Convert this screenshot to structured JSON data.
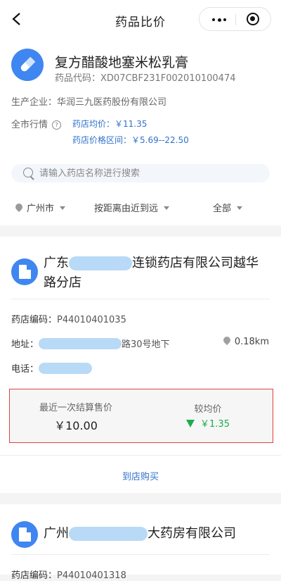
{
  "nav": {
    "title": "药品比价"
  },
  "drug": {
    "name": "复方醋酸地塞米松乳膏",
    "code_label": "药品代码：",
    "code": "XD07CBF231F002010100474",
    "maker_label": "生产企业：",
    "maker": "华润三九医药股份有限公司",
    "market_label": "全市行情",
    "q_mark": "?",
    "avg_label": "药店均价：",
    "avg_value": "￥11.35",
    "range_label": "药店价格区间：",
    "range_value": "￥5.69--22.50"
  },
  "search": {
    "placeholder": "请输入药店名称进行搜索"
  },
  "filters": {
    "city": "广州市",
    "sort": "按距离由近到远",
    "scope": "全部"
  },
  "stores": [
    {
      "name_prefix": "广东",
      "name_suffix": "连锁药店有限公司越华路分店",
      "code_label": "药店编码：",
      "code": "P44010401035",
      "address_label": "地址：",
      "address_suffix": "路30号地下",
      "distance": "0.18km",
      "phone_label": "电话：",
      "last_price_label": "最近一次结算售价",
      "last_price": "￥10.00",
      "diff_label": "较均价",
      "diff_value": "￥1.35",
      "buy_label": "到店购买"
    },
    {
      "name_prefix": "广州",
      "name_suffix": "大药房有限公司",
      "code_label": "药店编码：",
      "code": "P44010401318"
    }
  ],
  "colors": {
    "accent_blue": "#3f86f1",
    "link_blue": "#2f72c9",
    "down_green": "#1aad4b",
    "highlight_red": "#e04141"
  }
}
